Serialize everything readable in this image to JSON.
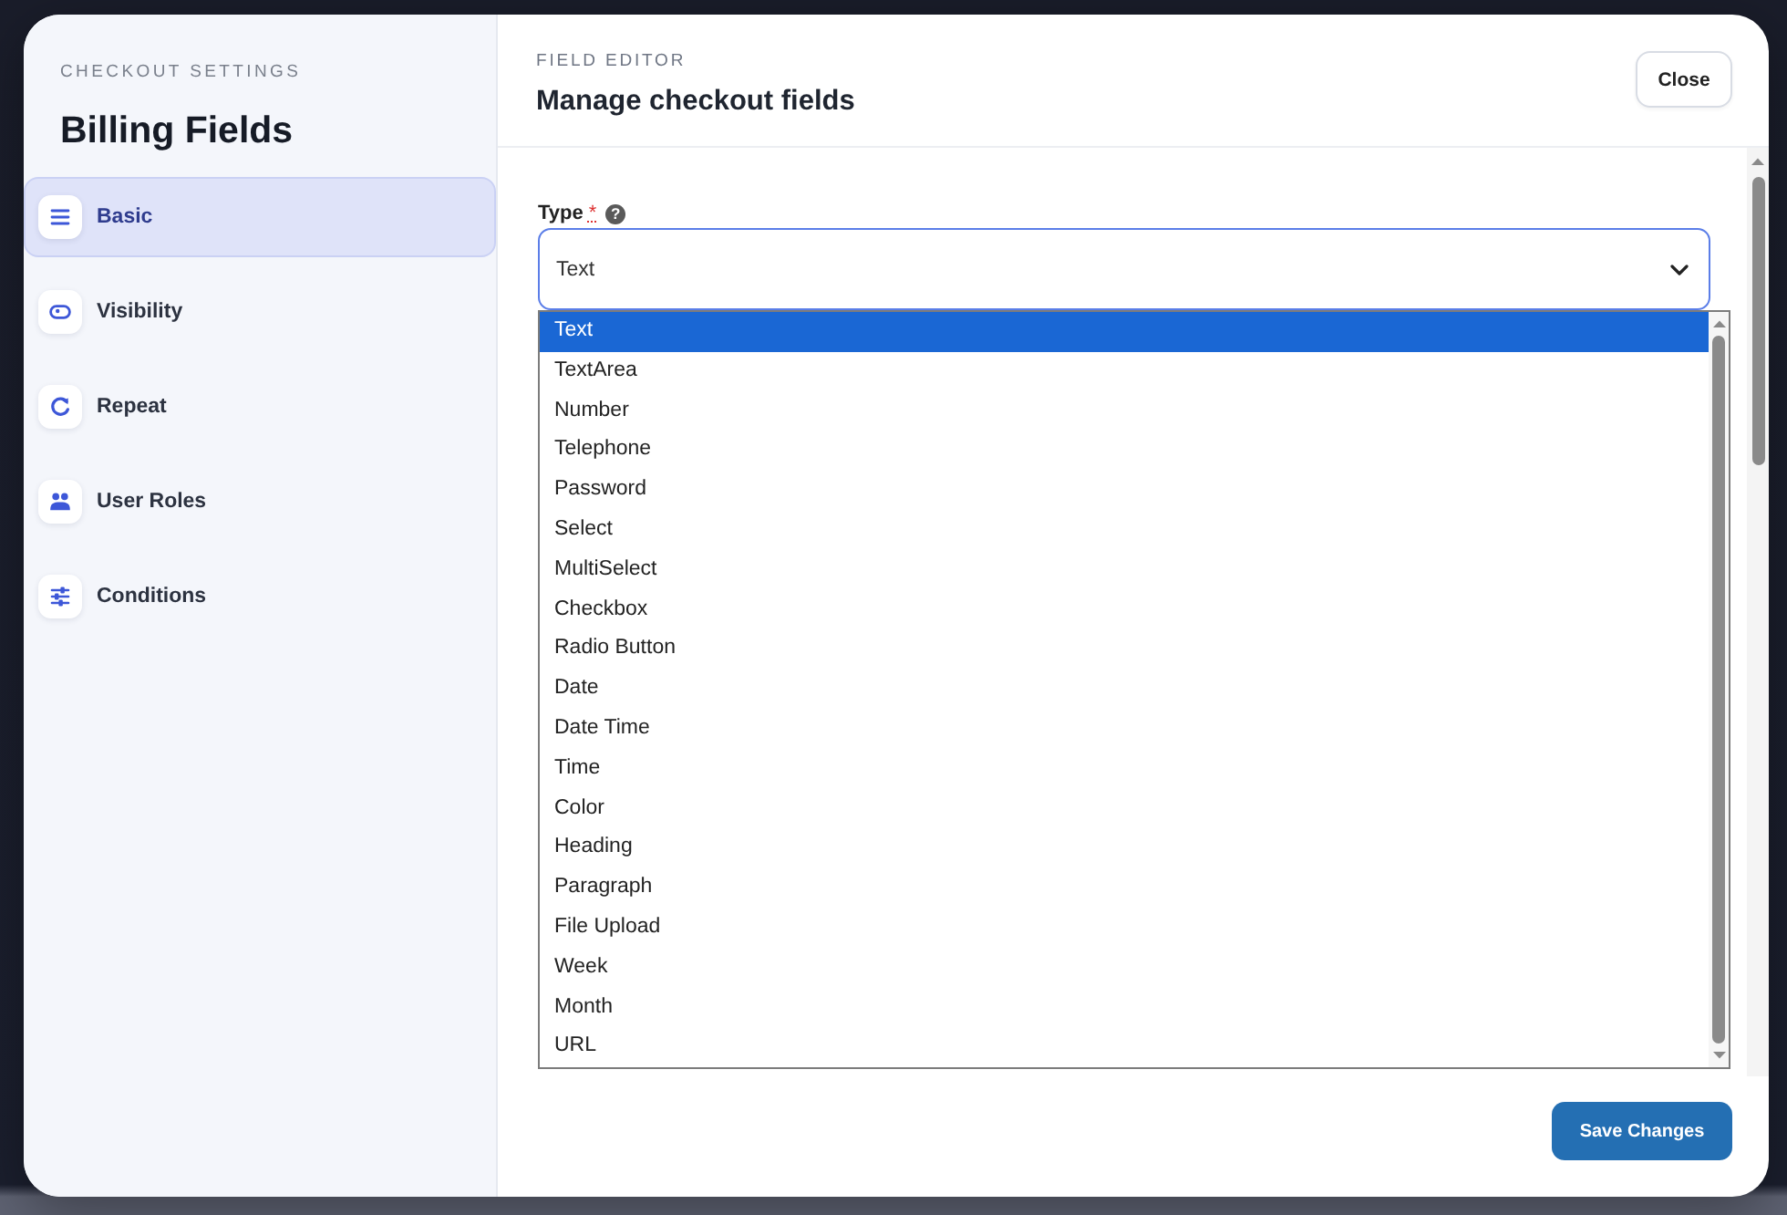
{
  "sidebar": {
    "eyebrow": "CHECKOUT SETTINGS",
    "title": "Billing Fields",
    "items": [
      {
        "label": "Basic",
        "selected": true
      },
      {
        "label": "Visibility",
        "selected": false
      },
      {
        "label": "Repeat",
        "selected": false
      },
      {
        "label": "User Roles",
        "selected": false
      },
      {
        "label": "Conditions",
        "selected": false
      }
    ]
  },
  "header": {
    "eyebrow": "FIELD EDITOR",
    "title": "Manage checkout fields",
    "close_button": "Close"
  },
  "type_field": {
    "label": "Type",
    "required_mark": "*",
    "help": "?",
    "value": "Text",
    "expanded": true,
    "options": [
      {
        "label": "Text",
        "selected": true
      },
      {
        "label": "TextArea",
        "selected": false
      },
      {
        "label": "Number",
        "selected": false
      },
      {
        "label": "Telephone",
        "selected": false
      },
      {
        "label": "Password",
        "selected": false
      },
      {
        "label": "Select",
        "selected": false
      },
      {
        "label": "MultiSelect",
        "selected": false
      },
      {
        "label": "Checkbox",
        "selected": false
      },
      {
        "label": "Radio Button",
        "selected": false
      },
      {
        "label": "Date",
        "selected": false
      },
      {
        "label": "Date Time",
        "selected": false
      },
      {
        "label": "Time",
        "selected": false
      },
      {
        "label": "Color",
        "selected": false
      },
      {
        "label": "Heading",
        "selected": false
      },
      {
        "label": "Paragraph",
        "selected": false
      },
      {
        "label": "File Upload",
        "selected": false
      },
      {
        "label": "Week",
        "selected": false
      },
      {
        "label": "Month",
        "selected": false
      },
      {
        "label": "URL",
        "selected": false
      }
    ]
  },
  "footer": {
    "save_button": "Save Changes"
  }
}
